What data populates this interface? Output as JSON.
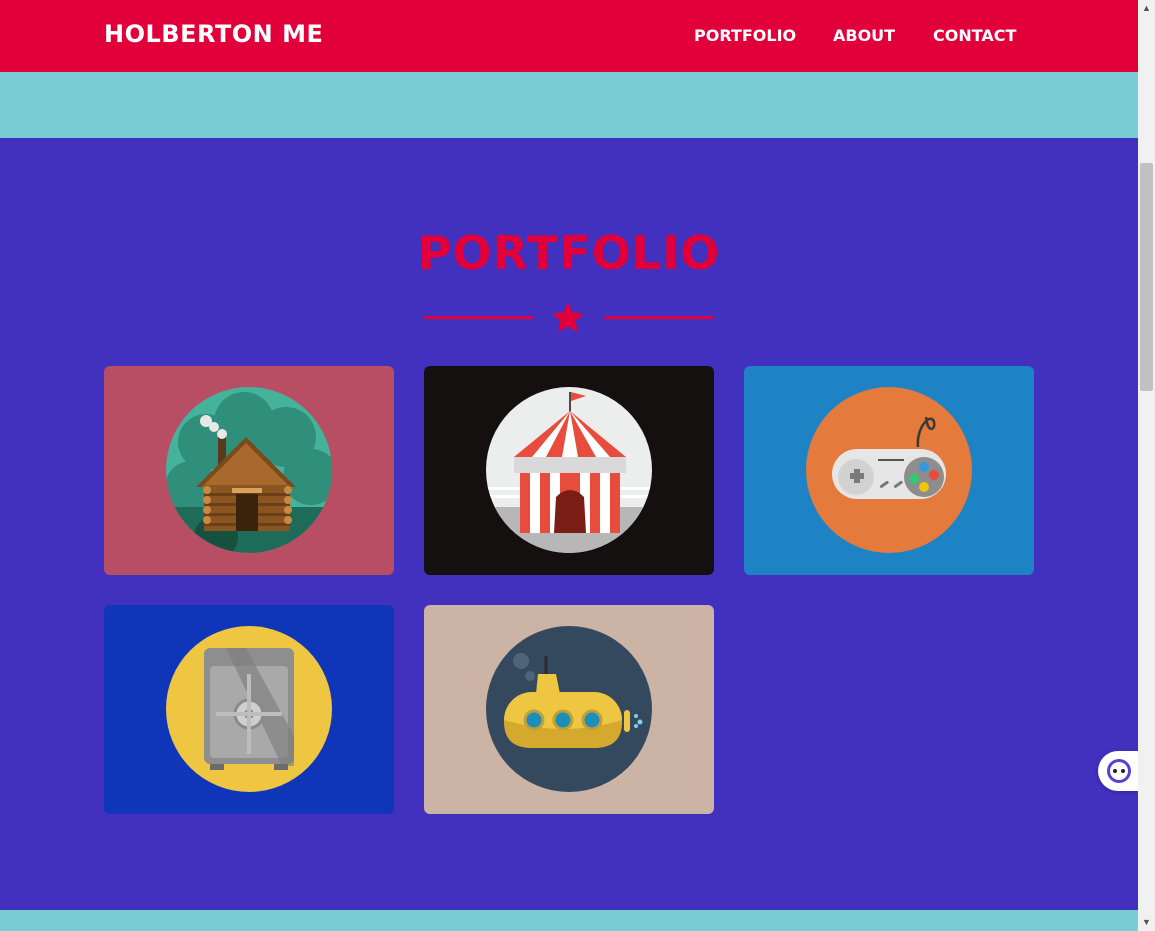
{
  "navbar": {
    "brand": "HOLBERTON ME",
    "links": [
      "PORTFOLIO",
      "ABOUT",
      "CONTACT"
    ]
  },
  "portfolio": {
    "title": "PORTFOLIO",
    "cards": [
      {
        "icon": "log-cabin-icon",
        "bg": "#b74e63"
      },
      {
        "icon": "circus-tent-icon",
        "bg": "#151010"
      },
      {
        "icon": "game-controller-icon",
        "bg": "#1d83c5"
      },
      {
        "icon": "safe-icon",
        "bg": "#0f35b8"
      },
      {
        "icon": "submarine-icon",
        "bg": "#cbb3a6"
      }
    ]
  },
  "colors": {
    "primary": "#e1003a",
    "accent": "#7accd4",
    "section_bg": "#4230be"
  },
  "scrollbar": {
    "up_arrow": "▲",
    "down_arrow": "▼"
  }
}
